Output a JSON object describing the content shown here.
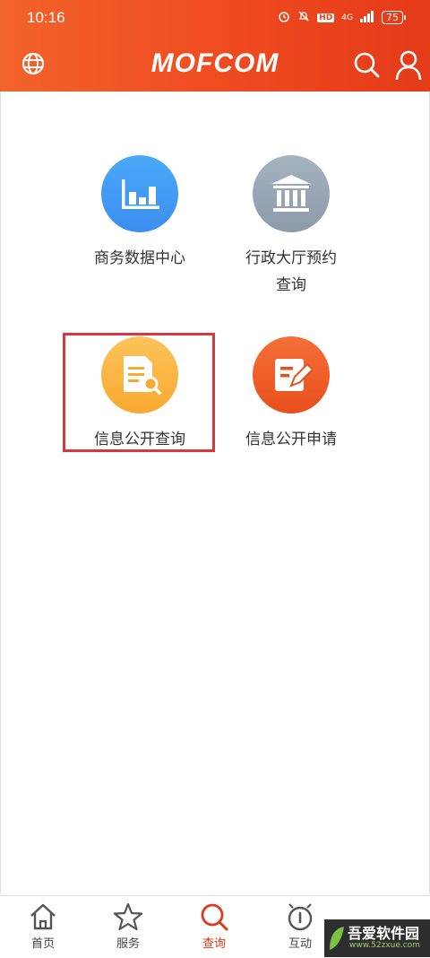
{
  "status_bar": {
    "time": "10:16",
    "network": "4G",
    "hd": "HD",
    "battery": "75"
  },
  "header": {
    "logo": "MOFCOM",
    "globe_icon": "globe-icon",
    "search_icon": "search-icon",
    "user_icon": "user-icon"
  },
  "tiles": [
    {
      "label": "商务数据中心",
      "icon": "bar-chart-icon",
      "color": "#3b8ff0"
    },
    {
      "label_line1": "行政大厅预约",
      "label_line2": "查询",
      "icon": "government-building-icon",
      "color": "#8c9aa9"
    },
    {
      "label": "信息公开查询",
      "icon": "document-search-icon",
      "color": "#f8a92f"
    },
    {
      "label": "信息公开申请",
      "icon": "edit-document-icon",
      "color": "#e94f1d"
    }
  ],
  "tabbar": {
    "items": [
      {
        "label": "首页",
        "icon": "home-icon"
      },
      {
        "label": "服务",
        "icon": "star-icon"
      },
      {
        "label": "查询",
        "icon": "search-icon",
        "active": true
      },
      {
        "label": "互动",
        "icon": "interact-icon"
      }
    ]
  },
  "watermark": {
    "text": "吾爱软件园",
    "url": "www.52zxue.com"
  },
  "colors": {
    "header_orange": "#ef4a1f",
    "active_tab": "#e2391a",
    "highlight_red": "#d7373f"
  }
}
